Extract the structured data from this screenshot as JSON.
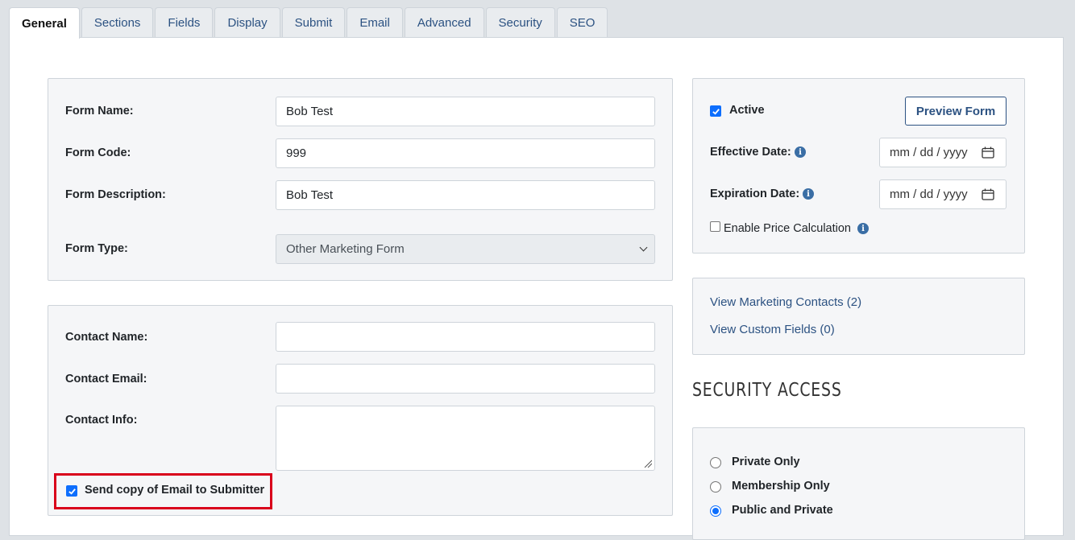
{
  "tabs": [
    {
      "label": "General",
      "active": true
    },
    {
      "label": "Sections"
    },
    {
      "label": "Fields"
    },
    {
      "label": "Display"
    },
    {
      "label": "Submit"
    },
    {
      "label": "Email"
    },
    {
      "label": "Advanced"
    },
    {
      "label": "Security"
    },
    {
      "label": "SEO"
    }
  ],
  "form": {
    "name_label": "Form Name:",
    "name_value": "Bob Test",
    "code_label": "Form Code:",
    "code_value": "999",
    "description_label": "Form Description:",
    "description_value": "Bob Test",
    "type_label": "Form Type:",
    "type_value": "Other Marketing Form"
  },
  "contact": {
    "name_label": "Contact Name:",
    "name_value": "",
    "email_label": "Contact Email:",
    "email_value": "",
    "info_label": "Contact Info:",
    "info_value": "",
    "send_copy_label": "Send copy of Email to Submitter",
    "send_copy_checked": true
  },
  "status": {
    "active_label": "Active",
    "active_checked": true,
    "preview_button": "Preview Form",
    "effective_label": "Effective Date:",
    "effective_placeholder": "mm / dd / yyyy",
    "expiration_label": "Expiration Date:",
    "expiration_placeholder": "mm / dd / yyyy",
    "price_calc_label": "Enable Price Calculation",
    "price_calc_checked": false
  },
  "links": {
    "marketing_contacts": "View Marketing Contacts (2)",
    "custom_fields": "View Custom Fields (0)"
  },
  "security": {
    "heading": "SECURITY ACCESS",
    "options": [
      {
        "label": "Private Only",
        "selected": false
      },
      {
        "label": "Membership Only",
        "selected": false
      },
      {
        "label": "Public and Private",
        "selected": true
      }
    ]
  },
  "colors": {
    "accent": "#0d6efd",
    "link": "#2c5282",
    "highlight": "#d9001b"
  }
}
